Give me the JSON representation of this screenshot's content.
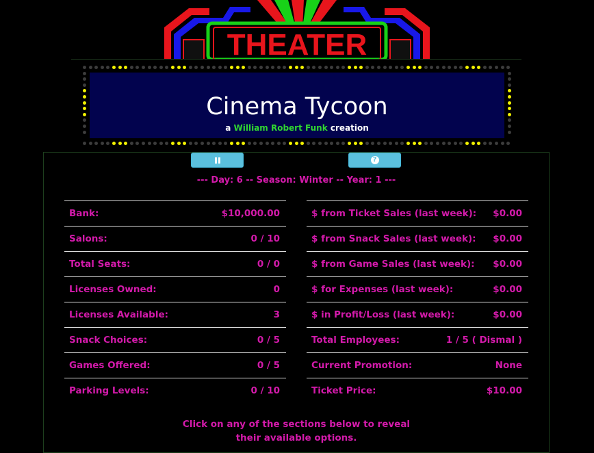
{
  "logo": {
    "text": "THEATER"
  },
  "marquee": {
    "title": "Cinema Tycoon",
    "byline_prefix": "a",
    "author": "William Robert Funk",
    "byline_suffix": "creation"
  },
  "controls": {
    "pause_icon": "pause-icon",
    "help_icon": "question-circle-icon",
    "button_color": "#5bc0de"
  },
  "status": {
    "dayline": "--- Day: 6 -- Season: Winter -- Year: 1 ---"
  },
  "stats_left": [
    {
      "label": "Bank:",
      "value": "$10,000.00"
    },
    {
      "label": "Salons:",
      "value": "0 / 10"
    },
    {
      "label": "Total Seats:",
      "value": "0 / 0"
    },
    {
      "label": "Licenses Owned:",
      "value": "0"
    },
    {
      "label": "Licenses Available:",
      "value": "3"
    },
    {
      "label": "Snack Choices:",
      "value": "0 / 5"
    },
    {
      "label": "Games Offered:",
      "value": "0 / 5"
    },
    {
      "label": "Parking Levels:",
      "value": "0 / 10"
    }
  ],
  "stats_right": [
    {
      "label": "$ from Ticket Sales (last week):",
      "value": "$0.00"
    },
    {
      "label": "$ from Snack Sales (last week):",
      "value": "$0.00"
    },
    {
      "label": "$ from Game Sales (last week):",
      "value": "$0.00"
    },
    {
      "label": "$ for Expenses (last week):",
      "value": "$0.00"
    },
    {
      "label": "$ in Profit/Loss (last week):",
      "value": "$0.00"
    },
    {
      "label": "Total Employees:",
      "value": "1 / 5 ( Dismal )"
    },
    {
      "label": "Current Promotion:",
      "value": "None"
    },
    {
      "label": "Ticket Price:",
      "value": "$10.00"
    }
  ],
  "instructions": {
    "line1": "Click on any of the sections below to reveal",
    "line2": "their available options."
  },
  "colors": {
    "accent": "#d31aaa",
    "author": "#31d631",
    "marquee_bg": "#02034e",
    "bulb_on": "#f2f200",
    "bulb_off": "#3c3c3c"
  }
}
